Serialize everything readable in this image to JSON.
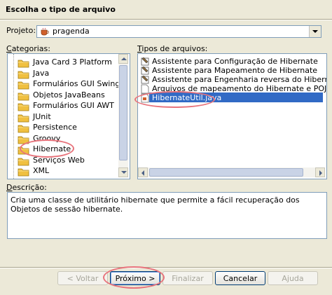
{
  "dialog": {
    "title": "Escolha o tipo de arquivo"
  },
  "project": {
    "label": "Projeto:",
    "value": "pragenda"
  },
  "categories": {
    "label": "Categorias:",
    "items": [
      "Java Card 3 Platform",
      "Java",
      "Formulários GUI Swing",
      "Objetos JavaBeans",
      "Formulários GUI AWT",
      "JUnit",
      "Persistence",
      "Groovy",
      "Hibernate",
      "Serviços Web",
      "XML"
    ],
    "selected": "Hibernate"
  },
  "file_types": {
    "label": "Tipos de arquivos:",
    "items": [
      "Assistente para Configuração de Hibernate",
      "Assistente para Mapeamento de Hibernate",
      "Assistente para Engenharia reversa do Hibernate",
      "Arquivos de mapeamento do Hibernate e POJOs de ban",
      "HibernateUtil.java"
    ],
    "selected": "HibernateUtil.java"
  },
  "description": {
    "label": "Descrição:",
    "text": "Cria uma classe de utilitário hibernate que permite a fácil recuperação dos Objetos de sessão hibernate."
  },
  "buttons": {
    "back": "< Voltar",
    "next": "Próximo >",
    "finish": "Finalizar",
    "cancel": "Cancelar",
    "help": "Ajuda"
  },
  "colors": {
    "selection": "#316ac5",
    "annotation": "#e8747c",
    "folder": "#f0c040"
  }
}
